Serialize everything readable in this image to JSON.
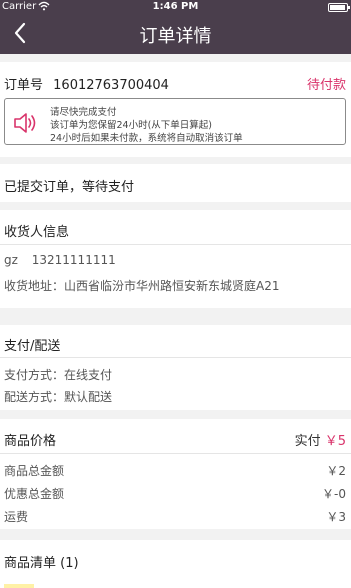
{
  "status_bar": {
    "carrier": "Carrier",
    "wifi_icon": "wifi-icon",
    "time": "1:46 PM",
    "battery_icon": "battery-icon"
  },
  "nav": {
    "back_icon": "chevron-left-icon",
    "title": "订单详情"
  },
  "order": {
    "number_label": "订单号",
    "number": "16012763700404",
    "status": "待付款"
  },
  "notice": {
    "icon": "speaker-icon",
    "lines": [
      "请尽快完成支付",
      "该订单为您保留24小时(从下单日算起)",
      "24小时后如果未付款，系统将自动取消该订单"
    ]
  },
  "progress": {
    "text": "已提交订单，等待支付"
  },
  "receiver": {
    "header": "收货人信息",
    "name": "gz",
    "phone": "13211111111",
    "address_label": "收货地址：",
    "address": "山西省临汾市华州路恒安新东城贤庭A21"
  },
  "payment": {
    "header": "支付/配送",
    "pay_label": "支付方式：",
    "pay_value": "在线支付",
    "ship_label": "配送方式：",
    "ship_value": "默认配送"
  },
  "price": {
    "header": "商品价格",
    "paid_label": "实付",
    "paid_value": "￥5",
    "rows": [
      {
        "label": "商品总金额",
        "value": "￥2"
      },
      {
        "label": "优惠总金额",
        "value": "￥-0"
      },
      {
        "label": "运费",
        "value": "￥3"
      }
    ]
  },
  "goods": {
    "header": "商品清单 (1)"
  },
  "colors": {
    "nav_bg": "#4a3e4c",
    "accent": "#d9346b"
  }
}
